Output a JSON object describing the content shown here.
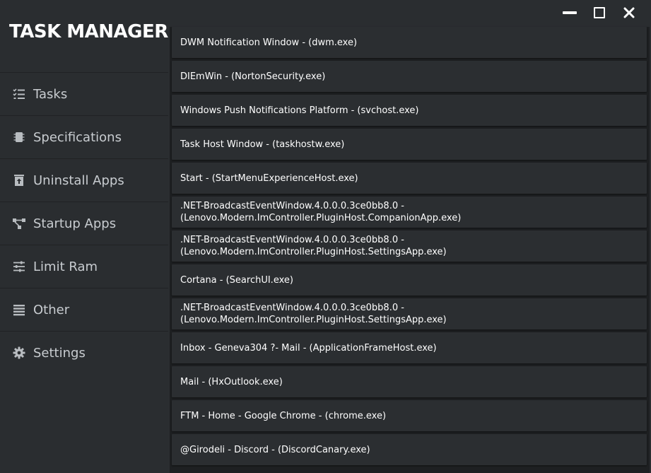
{
  "app": {
    "title": "TASK MANAGER"
  },
  "window_controls": {
    "minimize_icon": "minimize-icon",
    "maximize_icon": "maximize-icon",
    "close_icon": "close-icon"
  },
  "sidebar": {
    "items": [
      {
        "label": "Tasks",
        "icon": "task-list-icon"
      },
      {
        "label": "Specifications",
        "icon": "chip-icon"
      },
      {
        "label": "Uninstall Apps",
        "icon": "trash-upload-icon"
      },
      {
        "label": "Startup Apps",
        "icon": "flow-icon"
      },
      {
        "label": "Limit Ram",
        "icon": "sliders-icon"
      },
      {
        "label": "Other",
        "icon": "list-icon"
      },
      {
        "label": "Settings",
        "icon": "gear-icon"
      }
    ]
  },
  "processes": [
    "DWM Notification Window - (dwm.exe)",
    "DIEmWin - (NortonSecurity.exe)",
    "Windows Push Notifications Platform - (svchost.exe)",
    "Task Host Window - (taskhostw.exe)",
    "Start - (StartMenuExperienceHost.exe)",
    ".NET-BroadcastEventWindow.4.0.0.0.3ce0bb8.0 -\n(Lenovo.Modern.ImController.PluginHost.CompanionApp.exe)",
    ".NET-BroadcastEventWindow.4.0.0.0.3ce0bb8.0 -\n(Lenovo.Modern.ImController.PluginHost.SettingsApp.exe)",
    "Cortana - (SearchUI.exe)",
    ".NET-BroadcastEventWindow.4.0.0.0.3ce0bb8.0 -\n(Lenovo.Modern.ImController.PluginHost.SettingsApp.exe)",
    "Inbox - Geneva304 ?- Mail - (ApplicationFrameHost.exe)",
    "Mail - (HxOutlook.exe)",
    "FTM - Home - Google Chrome - (chrome.exe)",
    "@Girodeli - Discord - (DiscordCanary.exe)"
  ],
  "colors": {
    "background": "#2a2d30",
    "list_background": "#1e2022",
    "row_background": "#2b2e31",
    "text": "#ffffff",
    "nav_text": "#c8ccd0"
  }
}
